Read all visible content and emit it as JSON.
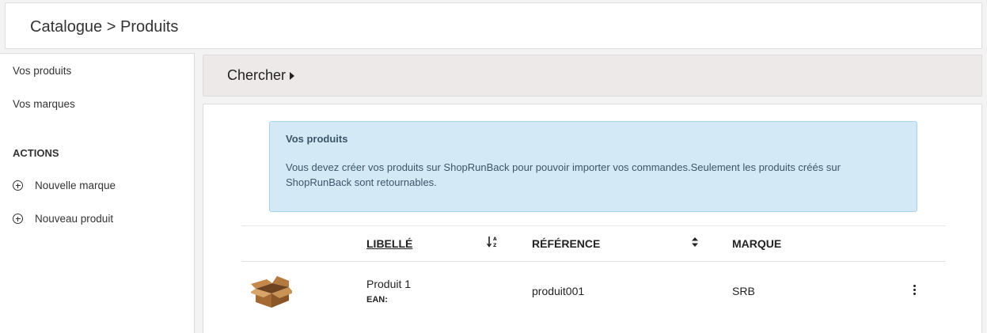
{
  "header": {
    "breadcrumb": "Catalogue > Produits"
  },
  "sidebar": {
    "links": [
      {
        "label": "Vos produits"
      },
      {
        "label": "Vos marques"
      }
    ],
    "actions_title": "ACTIONS",
    "actions": [
      {
        "label": "Nouvelle marque",
        "icon": "plus-circle-icon"
      },
      {
        "label": "Nouveau produit",
        "icon": "plus-circle-icon"
      }
    ]
  },
  "search": {
    "title": "Chercher"
  },
  "alert": {
    "title": "Vos produits",
    "body": "Vous devez créer vos produits sur ShopRunBack pour pouvoir importer vos commandes.Seulement les produits créés sur ShopRunBack sont retournables."
  },
  "table": {
    "columns": {
      "label": "LIBELLÉ",
      "reference": "RÉFÉRENCE",
      "brand": "MARQUE"
    },
    "rows": [
      {
        "image": "cardboard-box-icon",
        "label": "Produit 1",
        "ean_label": "EAN:",
        "reference": "produit001",
        "brand": "SRB"
      }
    ]
  },
  "colors": {
    "alert_bg": "#d4e9f6",
    "search_bg": "#ede9e8"
  }
}
